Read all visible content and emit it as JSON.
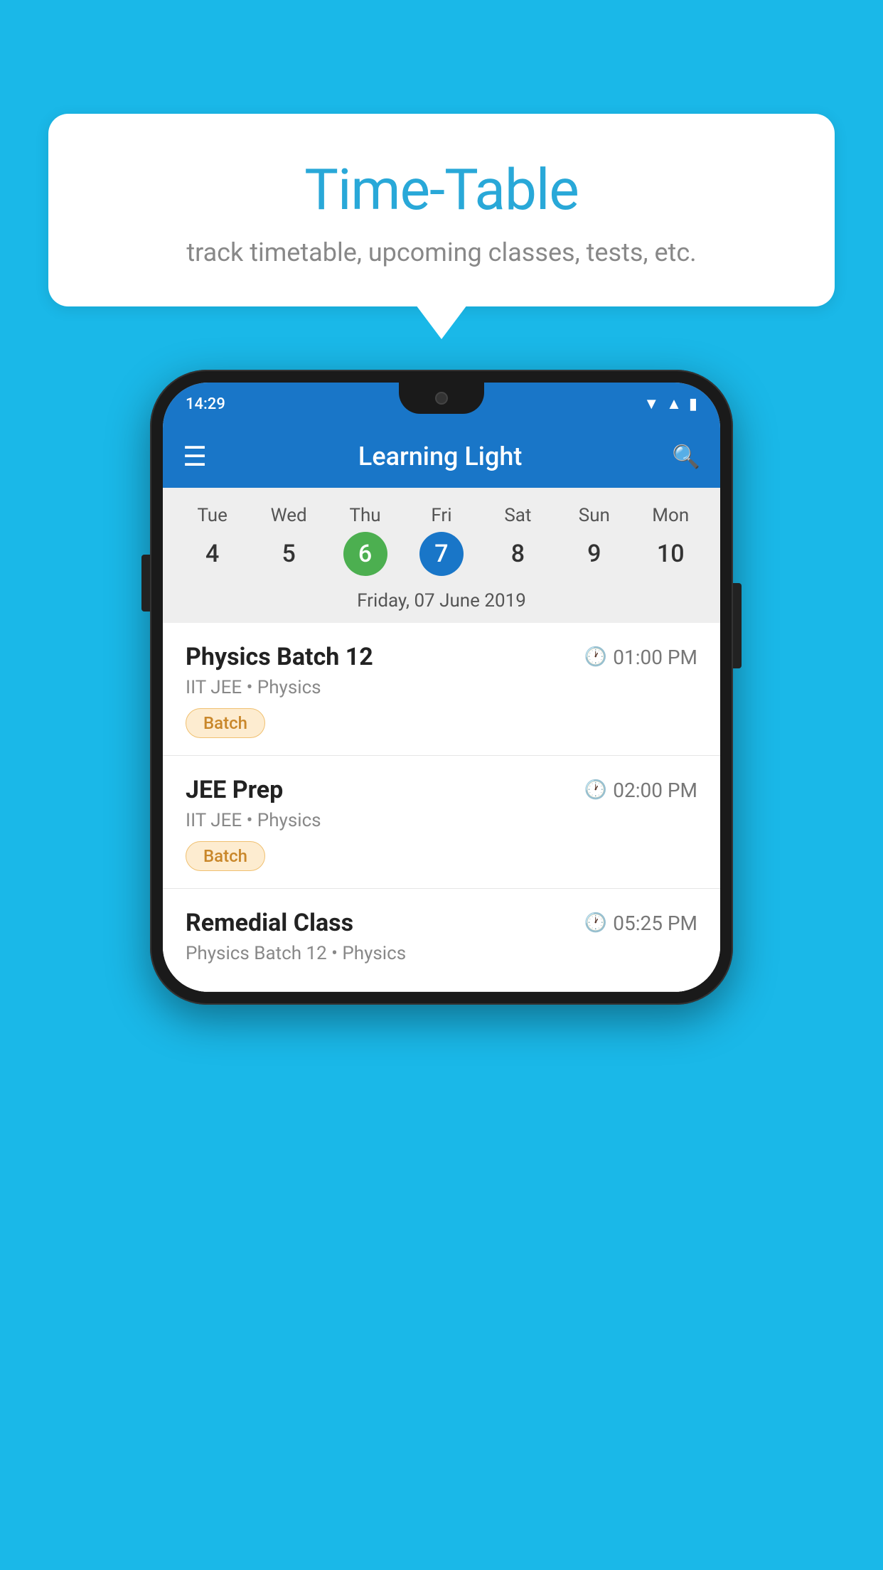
{
  "background_color": "#1ab8e8",
  "speech_bubble": {
    "title": "Time-Table",
    "subtitle": "track timetable, upcoming classes, tests, etc."
  },
  "phone": {
    "status_bar": {
      "time": "14:29",
      "wifi_icon": "▼",
      "signal_icon": "▲",
      "battery_icon": "▮"
    },
    "toolbar": {
      "menu_icon": "≡",
      "title": "Learning Light",
      "search_icon": "🔍"
    },
    "calendar": {
      "days": [
        {
          "label": "Tue",
          "number": "4",
          "state": "normal"
        },
        {
          "label": "Wed",
          "number": "5",
          "state": "normal"
        },
        {
          "label": "Thu",
          "number": "6",
          "state": "today"
        },
        {
          "label": "Fri",
          "number": "7",
          "state": "selected"
        },
        {
          "label": "Sat",
          "number": "8",
          "state": "normal"
        },
        {
          "label": "Sun",
          "number": "9",
          "state": "normal"
        },
        {
          "label": "Mon",
          "number": "10",
          "state": "normal"
        }
      ],
      "selected_date_label": "Friday, 07 June 2019"
    },
    "schedule": [
      {
        "title": "Physics Batch 12",
        "time": "01:00 PM",
        "subtitle": "IIT JEE • Physics",
        "badge": "Batch"
      },
      {
        "title": "JEE Prep",
        "time": "02:00 PM",
        "subtitle": "IIT JEE • Physics",
        "badge": "Batch"
      },
      {
        "title": "Remedial Class",
        "time": "05:25 PM",
        "subtitle": "Physics Batch 12 • Physics",
        "badge": null
      }
    ]
  }
}
